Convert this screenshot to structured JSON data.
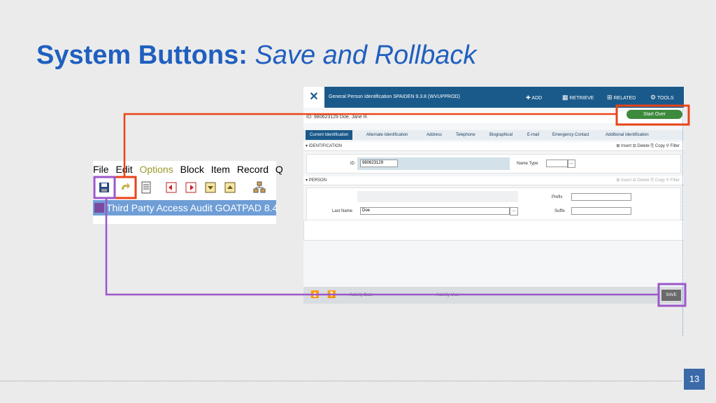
{
  "title": {
    "bold": "System Buttons:",
    "italic": "Save and Rollback"
  },
  "page_number": "13",
  "old_ui": {
    "menu": [
      {
        "label": "File",
        "dim": false
      },
      {
        "label": "Edit",
        "dim": false
      },
      {
        "label": "Options",
        "dim": true
      },
      {
        "label": "Block",
        "dim": false
      },
      {
        "label": "Item",
        "dim": false
      },
      {
        "label": "Record",
        "dim": false
      },
      {
        "label": "Q",
        "dim": false
      }
    ],
    "window_title": "Third Party Access Audit  GOATPAD  8.4",
    "toolbar_icons": [
      "save-icon",
      "rollback-icon",
      "document-icon",
      "record-first-icon",
      "record-prev-icon",
      "record-next-icon",
      "record-last-icon",
      "tree-icon"
    ]
  },
  "new_ui": {
    "header_title": "General Person Identification SPAIDEN 9.3.8 (WVUPPROD)",
    "header_buttons": {
      "add": "ADD",
      "retrieve": "RETRIEVE",
      "related": "RELATED",
      "tools": "TOOLS"
    },
    "start_over": "Start Over",
    "id_bar": {
      "label": "ID:",
      "id": "980623129",
      "name": "Doe, Jane R."
    },
    "tabs": [
      "Current Identification",
      "Alternate Identification",
      "Address",
      "Telephone",
      "Biographical",
      "E-mail",
      "Emergency Contact",
      "Additional Identification"
    ],
    "section_identification": "IDENTIFICATION",
    "section_person": "PERSON",
    "actions": {
      "insert": "Insert",
      "delete": "Delete",
      "copy": "Copy",
      "filter": "Filter"
    },
    "fields": {
      "id_label": "ID",
      "id_value": "980623129",
      "name_type_label": "Name Type",
      "prefix_label": "Prefix",
      "last_name_label": "Last Name",
      "last_name_value": "Doe",
      "suffix_label": "Suffix"
    },
    "footer": {
      "activity_date": "Activity Date",
      "activity_user": "Activity User"
    },
    "save": "SAVE"
  },
  "colors": {
    "title_blue": "#1f5fbf",
    "orange": "#e8441a",
    "purple": "#9b57c9",
    "banner_blue": "#1a5a8a",
    "start_over_green": "#3d8a3d"
  }
}
